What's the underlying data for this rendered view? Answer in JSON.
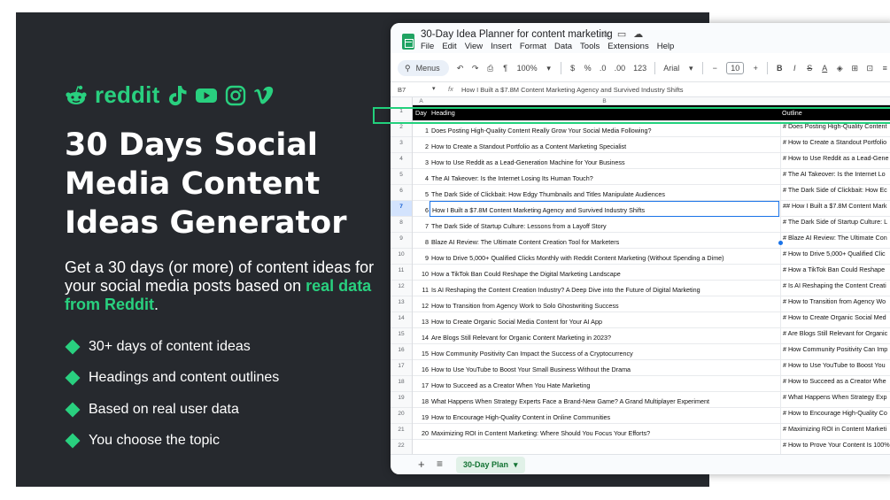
{
  "promo": {
    "brand_word": "reddit",
    "headline_lines": [
      "30 Days Social",
      "Media Content",
      "Ideas Generator"
    ],
    "subtext_before": "Get a 30 days (or more) of content ideas for your social media posts based on ",
    "subtext_highlight": "real data from Reddit",
    "subtext_after": ".",
    "bullets": [
      "30+ days of content ideas",
      "Headings and content outlines",
      "Based on real user data",
      "You choose the topic"
    ],
    "icons": [
      "reddit-icon",
      "tiktok-icon",
      "youtube-icon",
      "instagram-icon",
      "vimeo-icon"
    ],
    "accent_color": "#29d07f",
    "panel_color": "#26292e"
  },
  "sheet": {
    "title": "30-Day Idea Planner for content marketing",
    "menu": [
      "File",
      "Edit",
      "View",
      "Insert",
      "Format",
      "Data",
      "Tools",
      "Extensions",
      "Help"
    ],
    "toolbar": {
      "menus_label": "Menus",
      "zoom": "100%",
      "currency": "$",
      "percent": "%",
      "dec_less": ".0",
      "dec_more": ".00",
      "number_format": "123",
      "font": "Arial",
      "font_size": "10"
    },
    "name_box": "B7",
    "formula": "How I Built a $7.8M Content Marketing Agency and Survived Industry Shifts",
    "columns": [
      "A",
      "B"
    ],
    "header": {
      "day": "Day",
      "heading": "Heading",
      "outline": "Outline"
    },
    "rows": [
      {
        "day": "1",
        "heading": "Does Posting High-Quality Content Really Grow Your Social Media Following?",
        "outline": "# Does Posting High-Quality Content"
      },
      {
        "day": "2",
        "heading": "How to Create a Standout Portfolio as a Content Marketing Specialist",
        "outline": "# How to Create a Standout Portfolio"
      },
      {
        "day": "3",
        "heading": "How to Use Reddit as a Lead-Generation Machine for Your Business",
        "outline": "# How to Use Reddit as a Lead-Gene"
      },
      {
        "day": "4",
        "heading": "The AI Takeover: Is the Internet Losing Its Human Touch?",
        "outline": "# The AI Takeover: Is the Internet Lo"
      },
      {
        "day": "5",
        "heading": "The Dark Side of Clickbait: How Edgy Thumbnails and Titles Manipulate Audiences",
        "outline": "# The Dark Side of Clickbait: How Ec"
      },
      {
        "day": "6",
        "heading": "How I Built a $7.8M Content Marketing Agency and Survived Industry Shifts",
        "outline": "## How I Built a $7.8M Content Mark"
      },
      {
        "day": "7",
        "heading": "The Dark Side of Startup Culture: Lessons from a Layoff Story",
        "outline": "# The Dark Side of Startup Culture: L"
      },
      {
        "day": "8",
        "heading": "Blaze AI Review: The Ultimate Content Creation Tool for Marketers",
        "outline": "# Blaze AI Review: The Ultimate Con"
      },
      {
        "day": "9",
        "heading": "How to Drive 5,000+ Qualified Clicks Monthly with Reddit Content Marketing (Without Spending a Dime)",
        "outline": "# How to Drive 5,000+ Qualified Clic"
      },
      {
        "day": "10",
        "heading": "How a TikTok Ban Could Reshape the Digital Marketing Landscape",
        "outline": "# How a TikTok Ban Could Reshape"
      },
      {
        "day": "11",
        "heading": "Is AI Reshaping the Content Creation Industry? A Deep Dive into the Future of Digital Marketing",
        "outline": "# Is AI Reshaping the Content Creati"
      },
      {
        "day": "12",
        "heading": "How to Transition from Agency Work to Solo Ghostwriting Success",
        "outline": "# How to Transition from Agency Wo"
      },
      {
        "day": "13",
        "heading": "How to Create Organic Social Media Content for Your AI App",
        "outline": "# How to Create Organic Social Med"
      },
      {
        "day": "14",
        "heading": "Are Blogs Still Relevant for Organic Content Marketing in 2023?",
        "outline": "# Are Blogs Still Relevant for Organic"
      },
      {
        "day": "15",
        "heading": "How Community Positivity Can Impact the Success of a Cryptocurrency",
        "outline": "# How Community Positivity Can Imp"
      },
      {
        "day": "16",
        "heading": "How to Use YouTube to Boost Your Small Business Without the Drama",
        "outline": "# How to Use YouTube to Boost You"
      },
      {
        "day": "17",
        "heading": "How to Succeed as a Creator When You Hate Marketing",
        "outline": "# How to Succeed as a Creator Whe"
      },
      {
        "day": "18",
        "heading": "What Happens When Strategy Experts Face a Brand-New Game? A Grand Multiplayer Experiment",
        "outline": "# What Happens When Strategy Exp"
      },
      {
        "day": "19",
        "heading": "How to Encourage High-Quality Content in Online Communities",
        "outline": "# How to Encourage High-Quality Co"
      },
      {
        "day": "20",
        "heading": "Maximizing ROI in Content Marketing: Where Should You Focus Your Efforts?",
        "outline": "# Maximizing ROI in Content Marketi"
      },
      {
        "day": "",
        "heading": "",
        "outline": "# How to Prove Your Content Is 100%"
      }
    ],
    "row_numbers": [
      "1",
      "2",
      "3",
      "4",
      "5",
      "6",
      "7",
      "8",
      "9",
      "10",
      "11",
      "12",
      "13",
      "14",
      "15",
      "16",
      "17",
      "18",
      "19",
      "20",
      "21",
      "22"
    ],
    "selected_row": "7",
    "active_tab": "30-Day Plan"
  }
}
